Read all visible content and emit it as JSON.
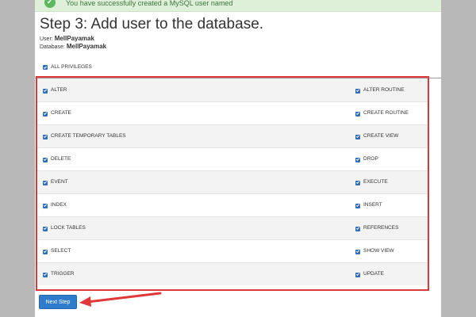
{
  "banner": {
    "text": "You have successfully created a MySQL user named",
    "icon": "check-circle-icon",
    "color": "#3c763d"
  },
  "header": {
    "title": "Step 3: Add user to the database."
  },
  "meta": {
    "user_label": "User:",
    "user_value": "MellPayamak",
    "database_label": "Database:",
    "database_value": "MellPayamak"
  },
  "all_privileges": {
    "label": "ALL PRIVILEGES",
    "checked": true
  },
  "privileges": {
    "rows": [
      {
        "left": "ALTER",
        "right": "ALTER ROUTINE"
      },
      {
        "left": "CREATE",
        "right": "CREATE ROUTINE"
      },
      {
        "left": "CREATE TEMPORARY TABLES",
        "right": "CREATE VIEW"
      },
      {
        "left": "DELETE",
        "right": "DROP"
      },
      {
        "left": "EVENT",
        "right": "EXECUTE"
      },
      {
        "left": "INDEX",
        "right": "INSERT"
      },
      {
        "left": "LOCK TABLES",
        "right": "REFERENCES"
      },
      {
        "left": "SELECT",
        "right": "SHOW VIEW"
      },
      {
        "left": "TRIGGER",
        "right": "UPDATE"
      }
    ]
  },
  "footer": {
    "next_label": "Next Step"
  },
  "colors": {
    "accent": "#2f7ccc",
    "highlight": "#e03838",
    "checkbox": "#2f6fb7",
    "banner_bg": "#dff0d8"
  }
}
